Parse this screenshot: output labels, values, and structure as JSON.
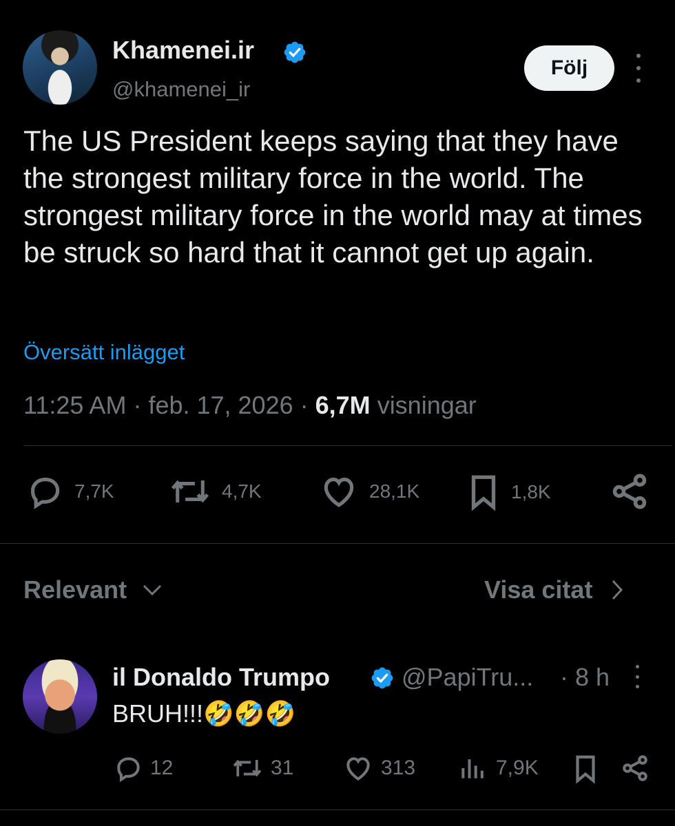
{
  "post": {
    "author_name": "Khamenei.ir",
    "author_handle": "@khamenei_ir",
    "follow_label": "Följ",
    "text": "The US President keeps saying that they have the strongest military force in the world. The strongest military force in the world may at times be struck so hard that it cannot get up again.",
    "translate_label": "Översätt inlägget",
    "time": "11:25 AM",
    "date": "feb. 17, 2026",
    "views_count": "6,7M",
    "views_label": "visningar",
    "actions": {
      "replies": "7,7K",
      "reposts": "4,7K",
      "likes": "28,1K",
      "bookmarks": "1,8K"
    }
  },
  "replies_header": {
    "sort_label": "Relevant",
    "quotes_label": "Visa citat"
  },
  "reply": {
    "author_name": "il Donaldo Trumpo",
    "author_handle": "@PapiTru...",
    "time": "8 h",
    "text": "BRUH!!!🤣🤣🤣",
    "actions": {
      "replies": "12",
      "reposts": "31",
      "likes": "313",
      "views": "7,9K"
    }
  },
  "colors": {
    "background": "#000000",
    "text": "#e7e9ea",
    "muted": "#71767b",
    "link": "#1d9bf0",
    "verified": "#1d9bf0",
    "divider": "#2f3336"
  }
}
